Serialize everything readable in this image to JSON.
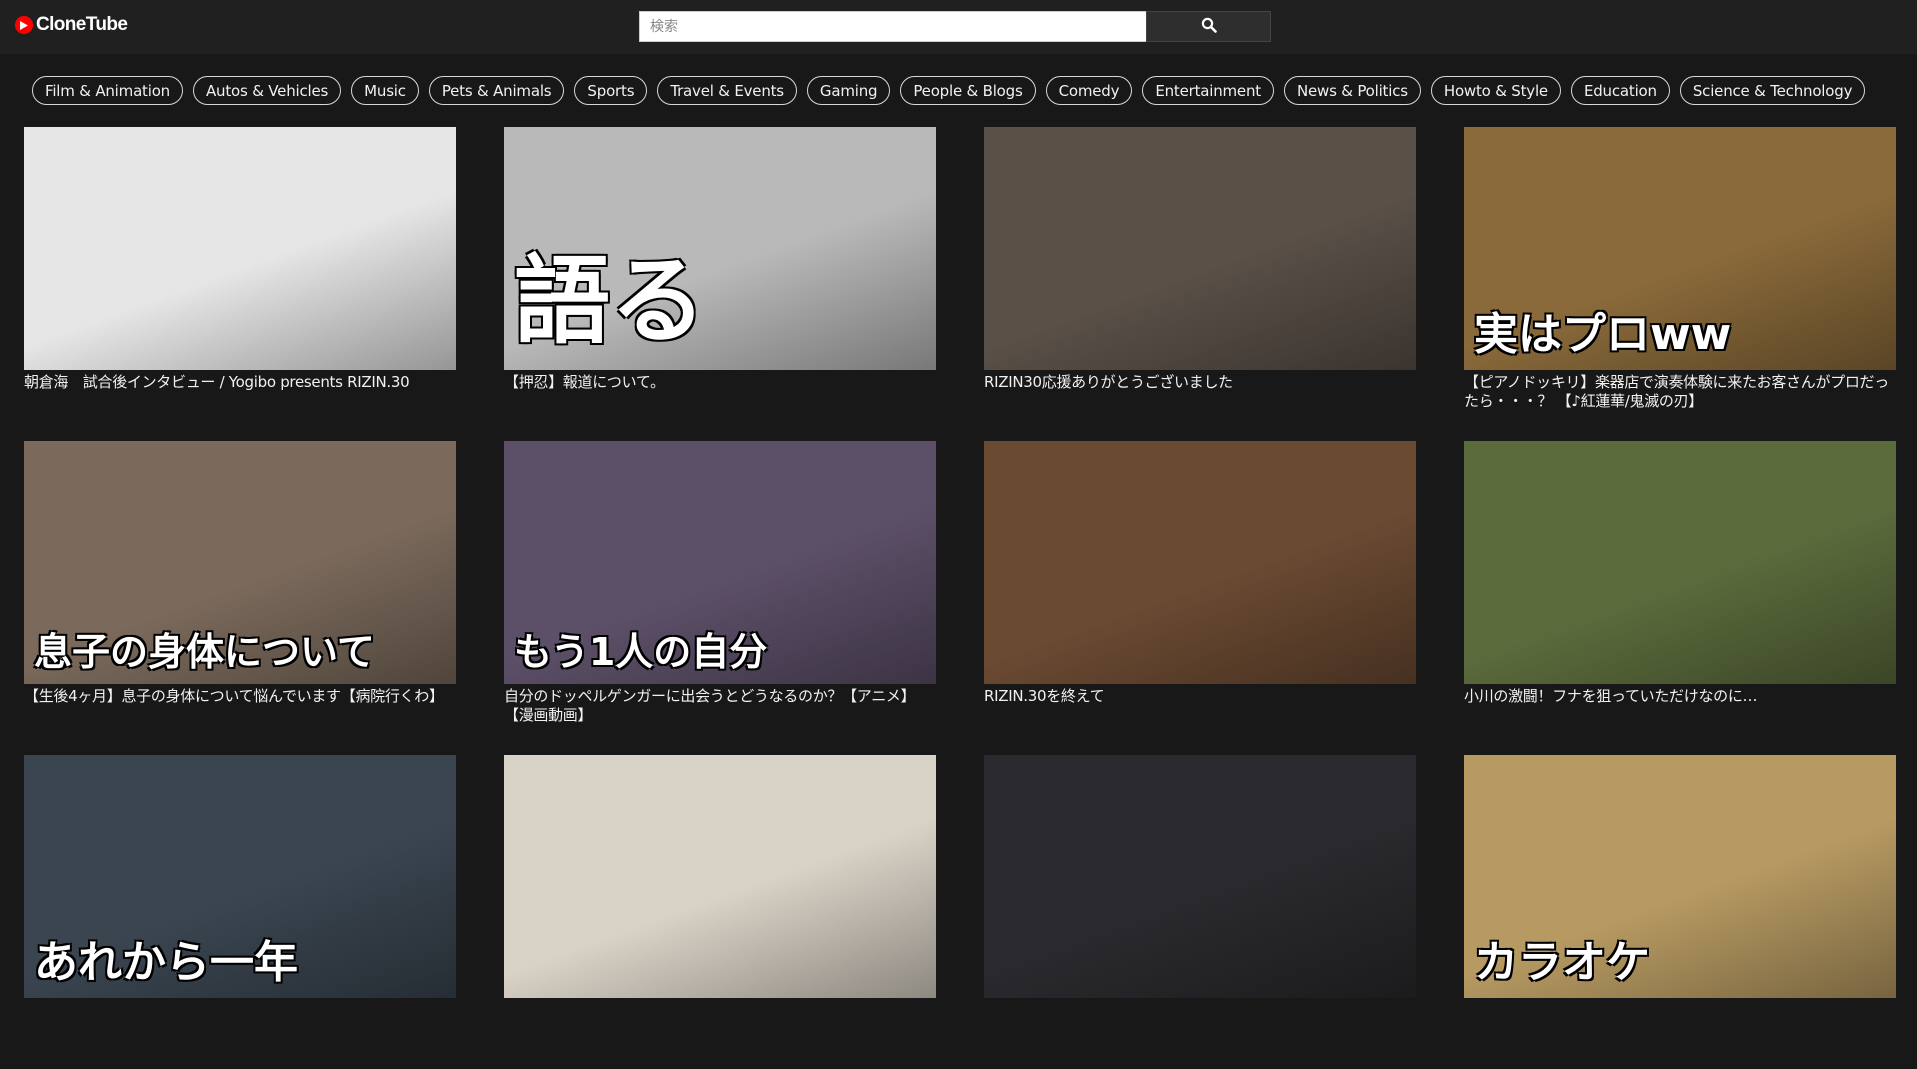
{
  "header": {
    "logo_text": "CloneTube",
    "search": {
      "placeholder": "検索",
      "value": ""
    }
  },
  "categories": [
    "Film & Animation",
    "Autos & Vehicles",
    "Music",
    "Pets & Animals",
    "Sports",
    "Travel & Events",
    "Gaming",
    "People & Blogs",
    "Comedy",
    "Entertainment",
    "News & Politics",
    "Howto & Style",
    "Education",
    "Science & Technology"
  ],
  "videos": [
    {
      "title": "朝倉海　試合後インタビュー / Yogibo presents RIZIN.30",
      "thumb_text": "",
      "thumb_bg": "#e6e6e6"
    },
    {
      "title": "【押忍】報道について。",
      "thumb_text": "語る",
      "thumb_bg": "#b9b9b9"
    },
    {
      "title": "RIZIN30応援ありがとうございました",
      "thumb_text": "",
      "thumb_bg": "#5a5048"
    },
    {
      "title": "【ピアノドッキリ】楽器店で演奏体験に来たお客さんがプロだったら・・・？ 【♪紅蓮華/鬼滅の刃】",
      "thumb_text": "実はプロww",
      "thumb_bg": "#8a6a3a"
    },
    {
      "title": "【生後4ヶ月】息子の身体について悩んでいます【病院行くわ】",
      "thumb_text": "息子の身体について",
      "thumb_bg": "#7b6a5c"
    },
    {
      "title": "自分のドッペルゲンガーに出会うとどうなるのか？【アニメ】【漫画動画】",
      "thumb_text": "もう1人の自分",
      "thumb_bg": "#5c4f68"
    },
    {
      "title": "RIZIN.30を終えて",
      "thumb_text": "",
      "thumb_bg": "#6b4a32"
    },
    {
      "title": "小川の激闘！フナを狙っていただけなのに…",
      "thumb_text": "",
      "thumb_bg": "#5b6b3c"
    },
    {
      "title": "",
      "thumb_text": "あれから一年",
      "thumb_bg": "#3a4550"
    },
    {
      "title": "",
      "thumb_text": "",
      "thumb_bg": "#d9d2c6"
    },
    {
      "title": "",
      "thumb_text": "",
      "thumb_bg": "#2a2a2e"
    },
    {
      "title": "",
      "thumb_text": "カラオケ",
      "thumb_bg": "#b79a62"
    }
  ]
}
